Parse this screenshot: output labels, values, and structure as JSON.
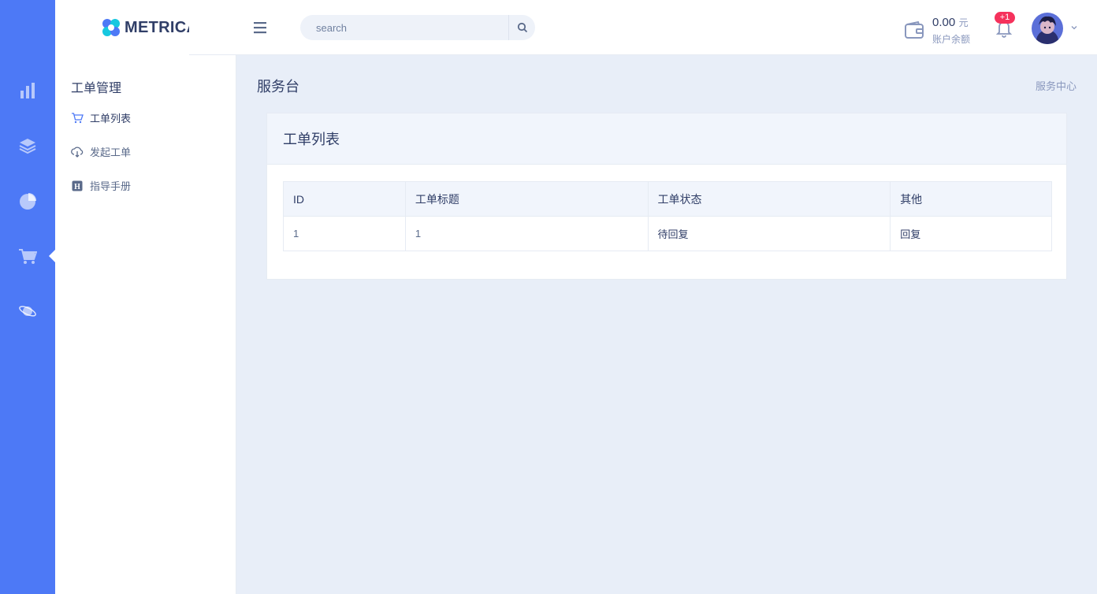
{
  "brand": {
    "name": "METRICA"
  },
  "rail": {
    "items": [
      {
        "name": "rail-analytics",
        "icon": "bar-chart-icon"
      },
      {
        "name": "rail-layers",
        "icon": "layers-icon"
      },
      {
        "name": "rail-pie",
        "icon": "pie-chart-icon"
      },
      {
        "name": "rail-cart",
        "icon": "cart-icon",
        "active": true
      },
      {
        "name": "rail-planet",
        "icon": "planet-icon"
      }
    ]
  },
  "subnav": {
    "title": "工单管理",
    "items": [
      {
        "label": "工单列表",
        "icon": "cart-icon",
        "active": true
      },
      {
        "label": "发起工单",
        "icon": "cloud-download-icon"
      },
      {
        "label": "指导手册",
        "icon": "handbook-icon"
      }
    ]
  },
  "search": {
    "placeholder": "search"
  },
  "wallet": {
    "amount": "0.00",
    "unit": "元",
    "label": "账户余额"
  },
  "notifications": {
    "badge": "+1"
  },
  "page": {
    "title": "服务台",
    "breadcrumb": "服务中心"
  },
  "card": {
    "title": "工单列表",
    "columns": [
      "ID",
      "工单标题",
      "工单状态",
      "其他"
    ],
    "rows": [
      {
        "id": "1",
        "title": "1",
        "status": "待回复",
        "action": "回复"
      }
    ]
  },
  "colors": {
    "primary": "#4d79f6",
    "badge": "#f5325c",
    "text": "#303e67",
    "muted": "#8997bd"
  }
}
